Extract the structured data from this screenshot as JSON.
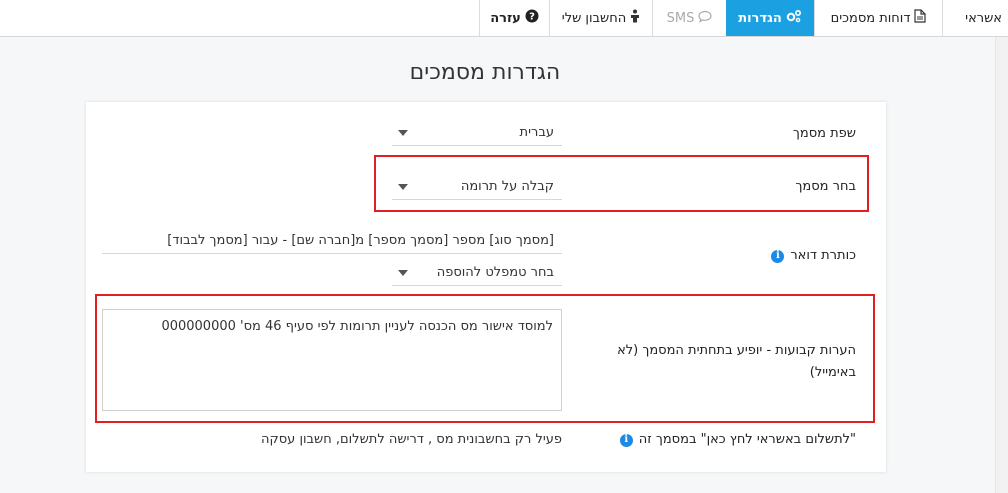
{
  "nav": {
    "tabs": [
      {
        "label": "אשראי",
        "state": "normal"
      },
      {
        "label": "דוחות מסמכים",
        "state": "normal",
        "icon": "document-icon"
      },
      {
        "label": "הגדרות",
        "state": "active",
        "icon": "gears-icon"
      },
      {
        "label": "SMS",
        "state": "disabled",
        "icon": "chat-bubble-icon"
      },
      {
        "label": "החשבון שלי",
        "state": "normal",
        "icon": "user-icon"
      },
      {
        "label": "עזרה",
        "state": "bold",
        "icon": "question-circle-icon"
      }
    ]
  },
  "page": {
    "title": "הגדרות מסמכים"
  },
  "form": {
    "language": {
      "label": "שפת מסמך",
      "value": "עברית"
    },
    "document": {
      "label": "בחר מסמך",
      "value": "קבלה על תרומה"
    },
    "email_title": {
      "label": "כותרת דואר",
      "value": "[מסמך סוג] מספר [מסמך מספר] מ[חברה שם] - עבור [מסמך לבבוד]",
      "template_select": "בחר טמפלט להוספה"
    },
    "notes": {
      "label": "הערות קבועות - יופיע בתחתית המסמך (לא באימייל)",
      "value": "למוסד אישור מס הכנסה לעניין תרומות לפי סעיף 46 מס' 000000000"
    },
    "pay_link": {
      "label": "\"לתשלום באשראי לחץ כאן\" במסמך זה",
      "value": "פעיל רק בחשבונית מס , דרישה לתשלום, חשבון עסקה"
    }
  },
  "colors": {
    "accent": "#1ba1e2",
    "highlight": "#e02020",
    "info": "#1e88e5"
  }
}
